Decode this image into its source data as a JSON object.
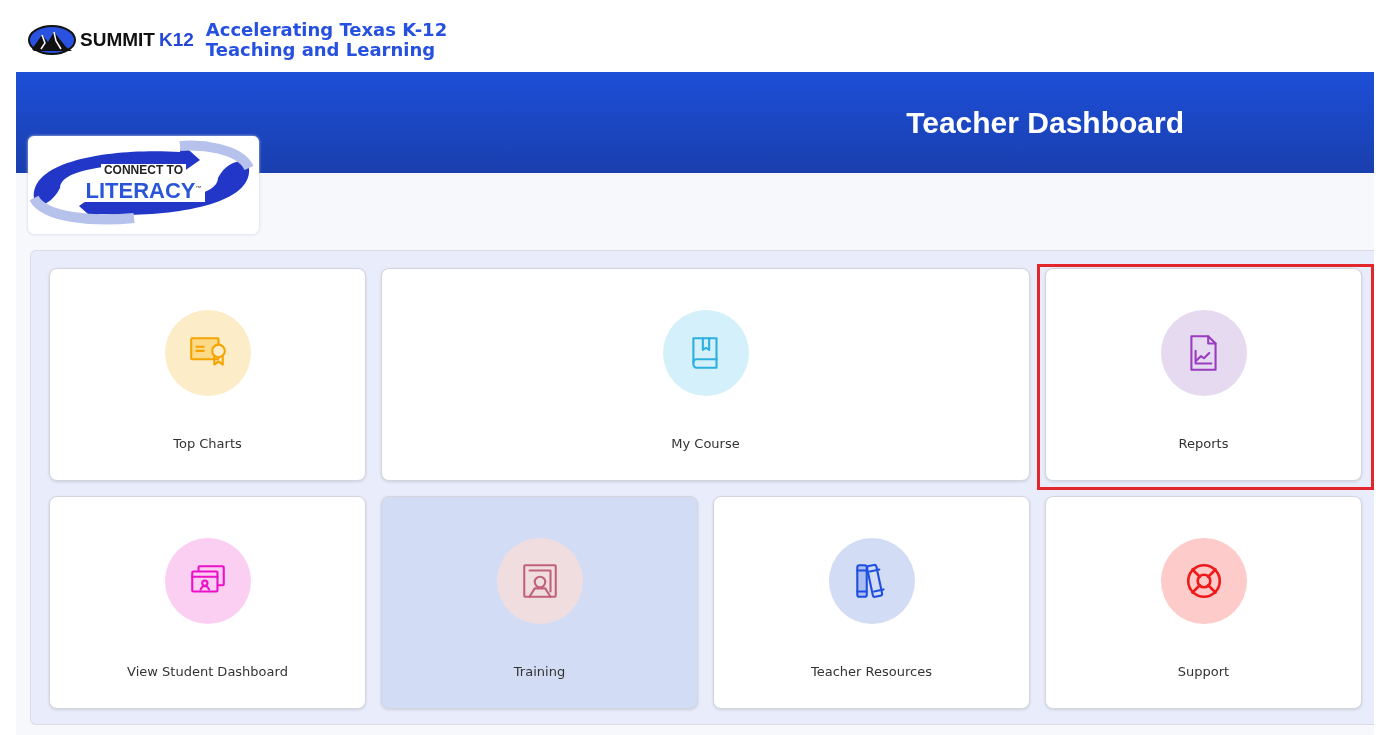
{
  "brand": {
    "name": "SUMMIT",
    "suffix": "K12",
    "tagline": [
      "Accelerating Texas K-12",
      "Teaching and Learning"
    ]
  },
  "banner": {
    "title": "Teacher Dashboard"
  },
  "program_logo": {
    "line_1": "CONNECT TO",
    "line_2": "LITERACY",
    "mark": "™"
  },
  "tiles": [
    {
      "label": "Top Charts",
      "kind": "normal",
      "selected": false,
      "highlighted": false
    },
    {
      "label": "My Course",
      "kind": "wide",
      "selected": false,
      "highlighted": false
    },
    {
      "label": "Reports",
      "kind": "normal",
      "selected": false,
      "highlighted": true
    },
    {
      "label": "View Student Dashboard",
      "kind": "normal",
      "selected": false,
      "highlighted": false
    },
    {
      "label": "Training",
      "kind": "normal",
      "selected": true,
      "highlighted": false
    },
    {
      "label": "Teacher Resources",
      "kind": "normal",
      "selected": false,
      "highlighted": false
    },
    {
      "label": "Support",
      "kind": "normal",
      "selected": false,
      "highlighted": false
    }
  ]
}
